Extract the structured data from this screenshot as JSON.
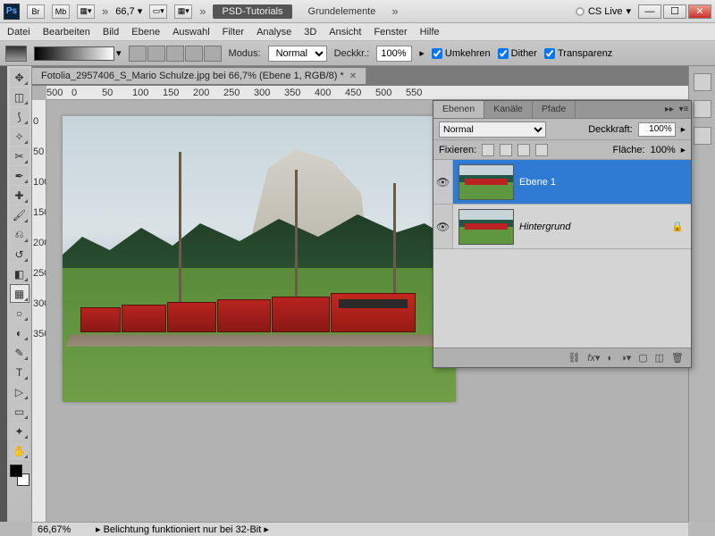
{
  "titlebar": {
    "ps": "Ps",
    "br": "Br",
    "mb": "Mb",
    "zoom": "66,7",
    "workspace_tab1": "PSD-Tutorials",
    "workspace_tab2": "Grundelemente",
    "cslive": "CS Live"
  },
  "menu": {
    "items": [
      "Datei",
      "Bearbeiten",
      "Bild",
      "Ebene",
      "Auswahl",
      "Filter",
      "Analyse",
      "3D",
      "Ansicht",
      "Fenster",
      "Hilfe"
    ]
  },
  "optbar": {
    "modus_label": "Modus:",
    "modus_value": "Normal",
    "deckkr_label": "Deckkr.:",
    "deckkr_value": "100%",
    "umkehren": "Umkehren",
    "dither": "Dither",
    "transparenz": "Transparenz"
  },
  "document": {
    "tab": "Fotolia_2957406_S_Mario Schulze.jpg bei 66,7% (Ebene 1, RGB/8) *"
  },
  "ruler_h": [
    "500",
    "0",
    "50",
    "100",
    "150",
    "200",
    "250",
    "300",
    "350",
    "400",
    "450",
    "500",
    "550"
  ],
  "ruler_v": [
    "0",
    "50",
    "100",
    "150",
    "200",
    "250",
    "300",
    "350"
  ],
  "layers_panel": {
    "tabs": [
      "Ebenen",
      "Kanäle",
      "Pfade"
    ],
    "blend": "Normal",
    "opacity_label": "Deckkraft:",
    "opacity_value": "100%",
    "fix_label": "Fixieren:",
    "fill_label": "Fläche:",
    "fill_value": "100%",
    "layers": [
      {
        "name": "Ebene 1",
        "selected": true,
        "locked": false
      },
      {
        "name": "Hintergrund",
        "selected": false,
        "locked": true
      }
    ]
  },
  "statusbar": {
    "zoom": "66,67%",
    "msg": "Belichtung funktioniert nur bei 32-Bit"
  }
}
